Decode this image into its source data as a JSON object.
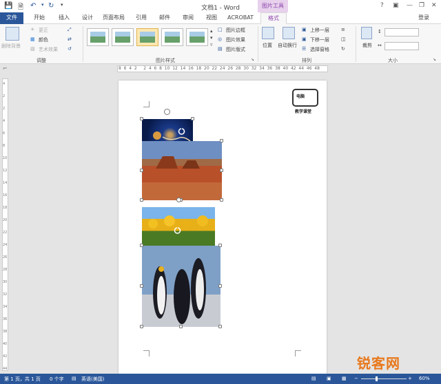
{
  "title_bar": {
    "doc_title": "文档1 - Word",
    "context_group": "图片工具",
    "help_icon": "?",
    "login": "登录"
  },
  "tabs": [
    "文件",
    "开始",
    "插入",
    "设计",
    "页面布局",
    "引用",
    "邮件",
    "审阅",
    "视图",
    "ACROBAT",
    "格式"
  ],
  "active_tab": "格式",
  "ribbon": {
    "adjust": {
      "remove_bg": "删除背景",
      "correct": "更正",
      "color": "颜色",
      "artistic": "艺术效果",
      "group": "调整"
    },
    "styles": {
      "border": "图片边框",
      "effects": "图片效果",
      "layout": "图片版式",
      "group": "图片样式"
    },
    "arrange": {
      "position": "位置",
      "wrap": "自动换行",
      "forward": "上移一层",
      "backward": "下移一层",
      "selection_pane": "选择窗格",
      "group": "排列"
    },
    "size": {
      "crop": "裁剪",
      "group": "大小"
    }
  },
  "ruler_text": "8  6  4  2     2  4  6  8  10  12  14  16  18  20  22  24  26  28  30  32  34  36  38  40  42  44  46  48",
  "vertical_ruler": [
    "4",
    "2",
    "2",
    "4",
    "6",
    "8",
    "10",
    "12",
    "14",
    "16",
    "18",
    "20",
    "22",
    "24",
    "26",
    "28",
    "30",
    "32",
    "34",
    "36",
    "38",
    "40",
    "42",
    "44"
  ],
  "logo": {
    "badge": "电脑",
    "caption": "教学课堂"
  },
  "status": {
    "page": "第 1 页，共 1 页",
    "words": "0 个字",
    "lang": "英语(美国)",
    "zoom": "60%"
  },
  "watermark": "锐客网"
}
